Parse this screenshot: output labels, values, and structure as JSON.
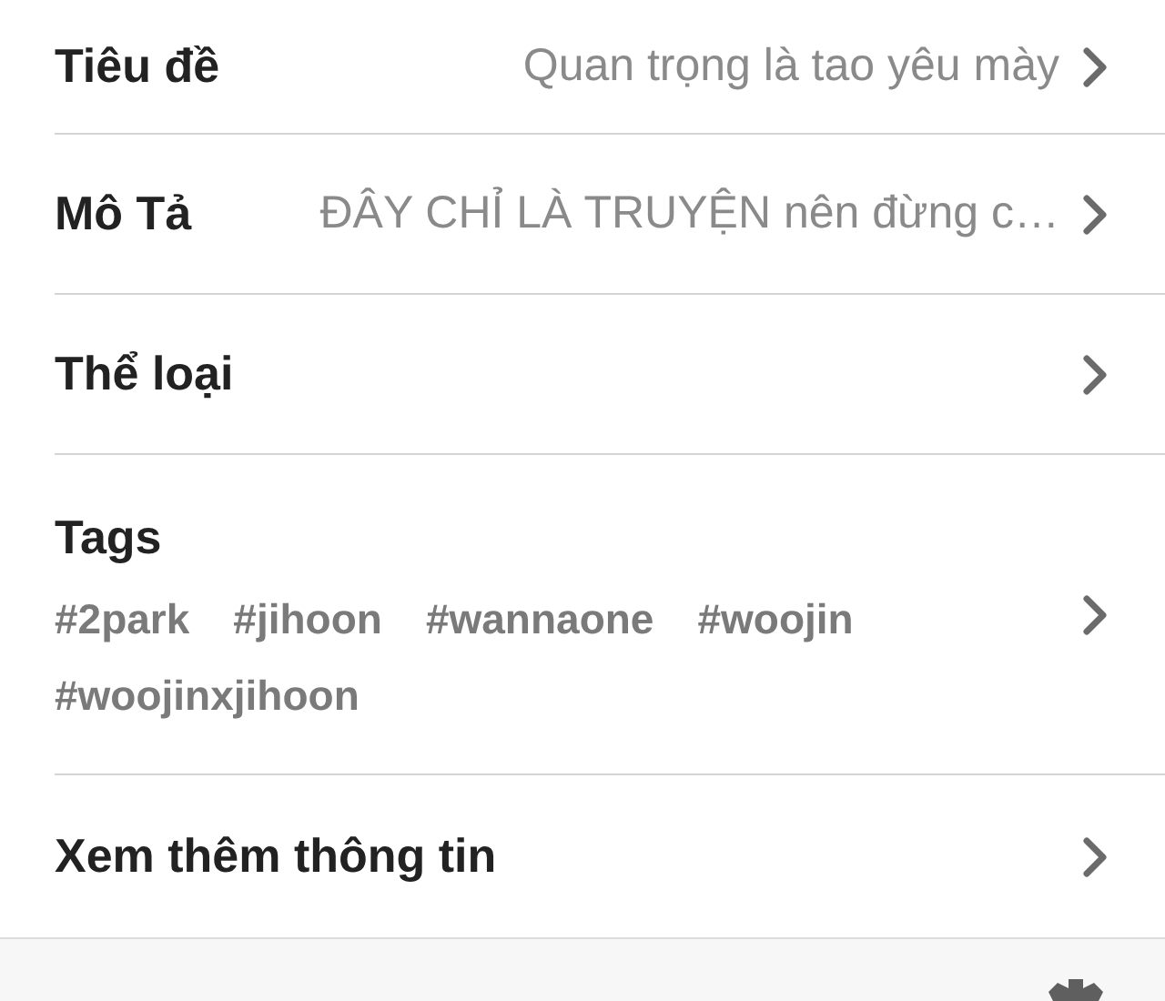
{
  "rows": [
    {
      "kind": "value",
      "label": "Tiêu đề",
      "value": "Quan trọng là tao yêu mày"
    },
    {
      "kind": "value",
      "label": "Mô Tả",
      "value": "ĐÂY CHỈ LÀ TRUYỆN nên đừng c…"
    },
    {
      "kind": "plain",
      "label": "Thể loại"
    },
    {
      "kind": "tags",
      "label": "Tags",
      "tags": [
        "#2park",
        "#jihoon",
        "#wannaone",
        "#woojin",
        "#woojinxjihoon"
      ]
    },
    {
      "kind": "plain",
      "label": "Xem thêm thông tin"
    }
  ]
}
